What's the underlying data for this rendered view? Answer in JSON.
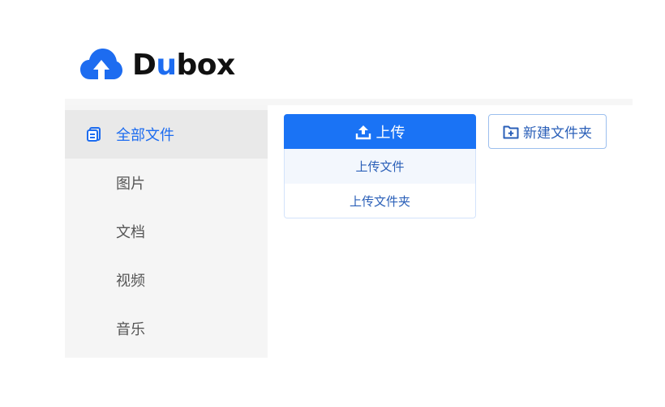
{
  "app": {
    "logo_text_start": "D",
    "logo_text_accent": "u",
    "logo_text_end": "box",
    "brand_color": "#1d6cf0"
  },
  "sidebar": {
    "items": [
      {
        "label": "全部文件",
        "icon": "files-icon",
        "active": true
      },
      {
        "label": "图片"
      },
      {
        "label": "文档"
      },
      {
        "label": "视频"
      },
      {
        "label": "音乐"
      }
    ]
  },
  "toolbar": {
    "upload_label": "上传",
    "upload_menu": [
      "上传文件",
      "上传文件夹"
    ],
    "new_folder_label": "新建文件夹"
  }
}
